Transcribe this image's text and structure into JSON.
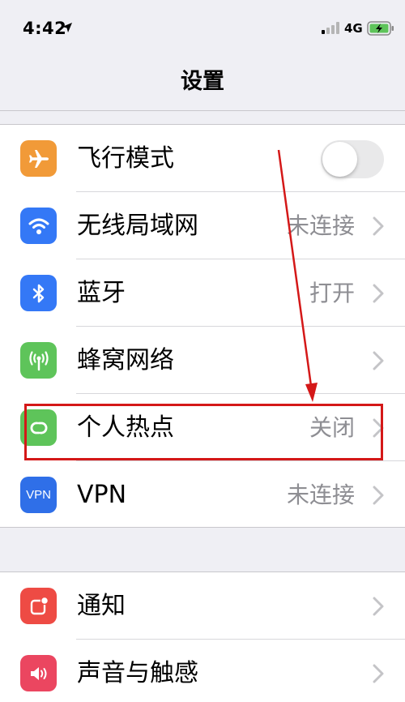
{
  "status_bar": {
    "time": "4:42",
    "network": "4G"
  },
  "nav": {
    "title": "设置"
  },
  "group1": [
    {
      "label": "飞行模式",
      "icon": "airplane-icon",
      "color": "#f19a38",
      "accessory": "toggle",
      "toggle_on": false
    },
    {
      "label": "无线局域网",
      "value": "未连接",
      "icon": "wifi-icon",
      "color": "#3478f6",
      "accessory": "chevron"
    },
    {
      "label": "蓝牙",
      "value": "打开",
      "icon": "bluetooth-icon",
      "color": "#3478f6",
      "accessory": "chevron"
    },
    {
      "label": "蜂窝网络",
      "icon": "cellular-antenna-icon",
      "color": "#5ec45a",
      "accessory": "chevron"
    },
    {
      "label": "个人热点",
      "value": "关闭",
      "icon": "hotspot-link-icon",
      "color": "#5ec45a",
      "accessory": "chevron"
    },
    {
      "label": "VPN",
      "value": "未连接",
      "icon": "vpn-icon",
      "icon_text": "VPN",
      "color": "#2f6fe8",
      "accessory": "chevron"
    }
  ],
  "group2": [
    {
      "label": "通知",
      "icon": "notification-icon",
      "color": "#ee4b44",
      "accessory": "chevron"
    },
    {
      "label": "声音与触感",
      "icon": "speaker-icon",
      "color": "#eb4660",
      "accessory": "chevron"
    }
  ],
  "annotation": {
    "color": "#d41818"
  }
}
